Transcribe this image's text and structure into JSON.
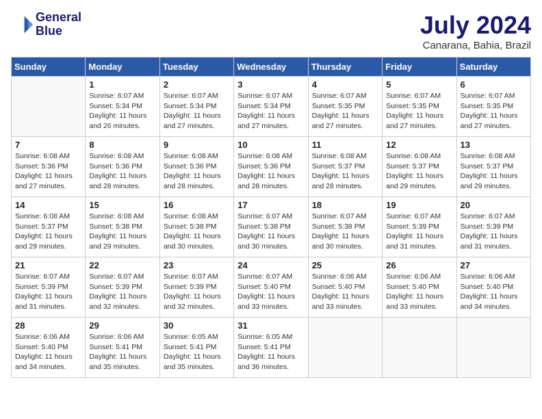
{
  "logo": {
    "line1": "General",
    "line2": "Blue"
  },
  "title": "July 2024",
  "location": "Canarana, Bahia, Brazil",
  "days_of_week": [
    "Sunday",
    "Monday",
    "Tuesday",
    "Wednesday",
    "Thursday",
    "Friday",
    "Saturday"
  ],
  "weeks": [
    [
      {
        "day": "",
        "info": ""
      },
      {
        "day": "1",
        "info": "Sunrise: 6:07 AM\nSunset: 5:34 PM\nDaylight: 11 hours\nand 26 minutes."
      },
      {
        "day": "2",
        "info": "Sunrise: 6:07 AM\nSunset: 5:34 PM\nDaylight: 11 hours\nand 27 minutes."
      },
      {
        "day": "3",
        "info": "Sunrise: 6:07 AM\nSunset: 5:34 PM\nDaylight: 11 hours\nand 27 minutes."
      },
      {
        "day": "4",
        "info": "Sunrise: 6:07 AM\nSunset: 5:35 PM\nDaylight: 11 hours\nand 27 minutes."
      },
      {
        "day": "5",
        "info": "Sunrise: 6:07 AM\nSunset: 5:35 PM\nDaylight: 11 hours\nand 27 minutes."
      },
      {
        "day": "6",
        "info": "Sunrise: 6:07 AM\nSunset: 5:35 PM\nDaylight: 11 hours\nand 27 minutes."
      }
    ],
    [
      {
        "day": "7",
        "info": "Sunrise: 6:08 AM\nSunset: 5:36 PM\nDaylight: 11 hours\nand 27 minutes."
      },
      {
        "day": "8",
        "info": "Sunrise: 6:08 AM\nSunset: 5:36 PM\nDaylight: 11 hours\nand 28 minutes."
      },
      {
        "day": "9",
        "info": "Sunrise: 6:08 AM\nSunset: 5:36 PM\nDaylight: 11 hours\nand 28 minutes."
      },
      {
        "day": "10",
        "info": "Sunrise: 6:08 AM\nSunset: 5:36 PM\nDaylight: 11 hours\nand 28 minutes."
      },
      {
        "day": "11",
        "info": "Sunrise: 6:08 AM\nSunset: 5:37 PM\nDaylight: 11 hours\nand 28 minutes."
      },
      {
        "day": "12",
        "info": "Sunrise: 6:08 AM\nSunset: 5:37 PM\nDaylight: 11 hours\nand 29 minutes."
      },
      {
        "day": "13",
        "info": "Sunrise: 6:08 AM\nSunset: 5:37 PM\nDaylight: 11 hours\nand 29 minutes."
      }
    ],
    [
      {
        "day": "14",
        "info": "Sunrise: 6:08 AM\nSunset: 5:37 PM\nDaylight: 11 hours\nand 29 minutes."
      },
      {
        "day": "15",
        "info": "Sunrise: 6:08 AM\nSunset: 5:38 PM\nDaylight: 11 hours\nand 29 minutes."
      },
      {
        "day": "16",
        "info": "Sunrise: 6:08 AM\nSunset: 5:38 PM\nDaylight: 11 hours\nand 30 minutes."
      },
      {
        "day": "17",
        "info": "Sunrise: 6:07 AM\nSunset: 5:38 PM\nDaylight: 11 hours\nand 30 minutes."
      },
      {
        "day": "18",
        "info": "Sunrise: 6:07 AM\nSunset: 5:38 PM\nDaylight: 11 hours\nand 30 minutes."
      },
      {
        "day": "19",
        "info": "Sunrise: 6:07 AM\nSunset: 5:39 PM\nDaylight: 11 hours\nand 31 minutes."
      },
      {
        "day": "20",
        "info": "Sunrise: 6:07 AM\nSunset: 5:39 PM\nDaylight: 11 hours\nand 31 minutes."
      }
    ],
    [
      {
        "day": "21",
        "info": "Sunrise: 6:07 AM\nSunset: 5:39 PM\nDaylight: 11 hours\nand 31 minutes."
      },
      {
        "day": "22",
        "info": "Sunrise: 6:07 AM\nSunset: 5:39 PM\nDaylight: 11 hours\nand 32 minutes."
      },
      {
        "day": "23",
        "info": "Sunrise: 6:07 AM\nSunset: 5:39 PM\nDaylight: 11 hours\nand 32 minutes."
      },
      {
        "day": "24",
        "info": "Sunrise: 6:07 AM\nSunset: 5:40 PM\nDaylight: 11 hours\nand 33 minutes."
      },
      {
        "day": "25",
        "info": "Sunrise: 6:06 AM\nSunset: 5:40 PM\nDaylight: 11 hours\nand 33 minutes."
      },
      {
        "day": "26",
        "info": "Sunrise: 6:06 AM\nSunset: 5:40 PM\nDaylight: 11 hours\nand 33 minutes."
      },
      {
        "day": "27",
        "info": "Sunrise: 6:06 AM\nSunset: 5:40 PM\nDaylight: 11 hours\nand 34 minutes."
      }
    ],
    [
      {
        "day": "28",
        "info": "Sunrise: 6:06 AM\nSunset: 5:40 PM\nDaylight: 11 hours\nand 34 minutes."
      },
      {
        "day": "29",
        "info": "Sunrise: 6:06 AM\nSunset: 5:41 PM\nDaylight: 11 hours\nand 35 minutes."
      },
      {
        "day": "30",
        "info": "Sunrise: 6:05 AM\nSunset: 5:41 PM\nDaylight: 11 hours\nand 35 minutes."
      },
      {
        "day": "31",
        "info": "Sunrise: 6:05 AM\nSunset: 5:41 PM\nDaylight: 11 hours\nand 36 minutes."
      },
      {
        "day": "",
        "info": ""
      },
      {
        "day": "",
        "info": ""
      },
      {
        "day": "",
        "info": ""
      }
    ]
  ]
}
